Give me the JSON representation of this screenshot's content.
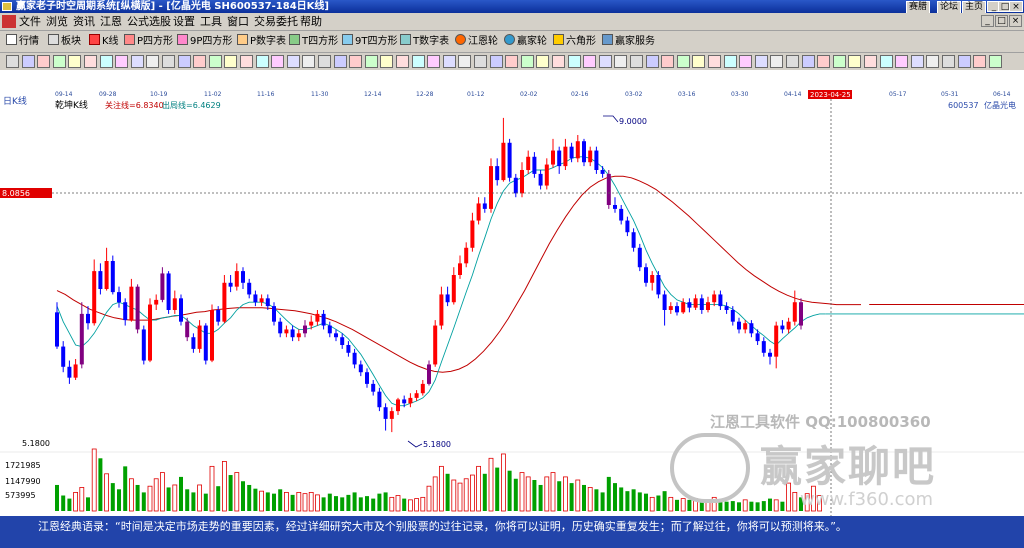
{
  "window": {
    "title": "赢家老子时空周期系统[纵横版] - [亿晶光电   SH600537-184日K线]",
    "top_links": [
      "赛腊",
      "论坛",
      "主页"
    ],
    "controls": [
      "_",
      "□",
      "×"
    ]
  },
  "menu": [
    "文件",
    "浏览",
    "资讯",
    "江恩",
    "公式选股",
    "设置",
    "工具",
    "窗口",
    "交易委托",
    "帮助"
  ],
  "toolbar": [
    {
      "label": "行情",
      "icon": "quote-table-icon"
    },
    {
      "label": "板块",
      "icon": "sector-icon"
    },
    {
      "label": "K线",
      "icon": "kline-icon"
    },
    {
      "label": "P四方形",
      "icon": "p-square-icon"
    },
    {
      "label": "9P四方形",
      "icon": "9p-square-icon"
    },
    {
      "label": "P数字表",
      "icon": "p-number-table-icon"
    },
    {
      "label": "T四方形",
      "icon": "t-square-icon"
    },
    {
      "label": "9T四方形",
      "icon": "9t-square-icon"
    },
    {
      "label": "T数字表",
      "icon": "t-number-table-icon"
    },
    {
      "label": "江恩轮",
      "icon": "gann-wheel-icon"
    },
    {
      "label": "赢家轮",
      "icon": "winner-wheel-icon"
    },
    {
      "label": "六角形",
      "icon": "hexagon-icon"
    },
    {
      "label": "赢家服务",
      "icon": "service-icon"
    }
  ],
  "chart": {
    "period_label": "日K线",
    "indicator_label": "乾坤K线",
    "watch_line_label": "关注线=6.8340",
    "exit_line_label": "出局线=6.4629",
    "code_label": "600537",
    "stock_name": "亿晶光电",
    "price_tag": "8.0856",
    "high_label": "9.0000",
    "low_label": "5.1800",
    "axis_low": "5.1800",
    "cursor_date": "2023-04-25",
    "watermark_line1": "江恩工具软件  QQ:100800360",
    "watermark_line2": "赢家聊吧",
    "watermark_line3": "www.f360.com",
    "colors": {
      "up": "#ff0000",
      "down": "#0000ff",
      "special": "#800080",
      "ma_short": "#00a0a0",
      "ma_long": "#c00000"
    }
  },
  "dates": [
    "09-14",
    "09-28",
    "10-19",
    "11-02",
    "11-16",
    "11-30",
    "12-14",
    "12-28",
    "01-12",
    "02-02",
    "02-16",
    "03-02",
    "03-16",
    "03-30",
    "04-14",
    "2023-04-25",
    "05-17",
    "05-31",
    "06-14"
  ],
  "volume": {
    "labels": [
      "1721985",
      "1147990",
      "573995"
    ]
  },
  "chart_data": {
    "type": "candlestick",
    "candles": [
      [
        6.72,
        6.28,
        6.85,
        6.25
      ],
      [
        6.28,
        6.02,
        6.35,
        5.95
      ],
      [
        6.02,
        5.88,
        6.1,
        5.8
      ],
      [
        5.88,
        6.05,
        6.12,
        5.85
      ],
      [
        6.05,
        6.7,
        6.85,
        6.0
      ],
      [
        6.7,
        6.58,
        6.8,
        6.5
      ],
      [
        6.58,
        7.25,
        7.4,
        6.55
      ],
      [
        7.25,
        7.02,
        7.35,
        6.95
      ],
      [
        7.02,
        7.38,
        7.55,
        7.0
      ],
      [
        7.38,
        6.98,
        7.45,
        6.95
      ],
      [
        6.98,
        6.85,
        7.05,
        6.78
      ],
      [
        6.85,
        6.62,
        6.9,
        6.55
      ],
      [
        6.62,
        7.05,
        7.15,
        6.6
      ],
      [
        7.05,
        6.5,
        7.08,
        6.45
      ],
      [
        6.5,
        6.1,
        6.55,
        6.05
      ],
      [
        6.1,
        6.82,
        6.9,
        6.08
      ],
      [
        6.82,
        6.88,
        6.95,
        6.75
      ],
      [
        6.88,
        7.22,
        7.3,
        6.85
      ],
      [
        7.22,
        6.75,
        7.25,
        6.7
      ],
      [
        6.75,
        6.9,
        7.0,
        6.7
      ],
      [
        6.9,
        6.6,
        6.95,
        6.55
      ],
      [
        6.6,
        6.4,
        6.65,
        6.35
      ],
      [
        6.4,
        6.25,
        6.45,
        6.2
      ],
      [
        6.25,
        6.55,
        6.62,
        6.2
      ],
      [
        6.55,
        6.1,
        6.58,
        6.05
      ],
      [
        6.1,
        6.75,
        6.82,
        6.08
      ],
      [
        6.75,
        6.6,
        6.8,
        6.55
      ],
      [
        6.6,
        7.1,
        7.2,
        6.58
      ],
      [
        7.1,
        7.05,
        7.2,
        6.98
      ],
      [
        7.05,
        7.25,
        7.35,
        7.0
      ],
      [
        7.25,
        7.1,
        7.3,
        7.02
      ],
      [
        7.1,
        6.95,
        7.15,
        6.9
      ],
      [
        6.95,
        6.85,
        7.0,
        6.8
      ],
      [
        6.85,
        6.9,
        6.95,
        6.8
      ],
      [
        6.9,
        6.8,
        6.95,
        6.75
      ],
      [
        6.8,
        6.6,
        6.85,
        6.55
      ],
      [
        6.6,
        6.45,
        6.65,
        6.4
      ],
      [
        6.45,
        6.5,
        6.55,
        6.4
      ],
      [
        6.5,
        6.4,
        6.55,
        6.35
      ],
      [
        6.4,
        6.45,
        6.5,
        6.35
      ],
      [
        6.45,
        6.55,
        6.62,
        6.4
      ],
      [
        6.55,
        6.6,
        6.68,
        6.5
      ],
      [
        6.6,
        6.7,
        6.75,
        6.55
      ],
      [
        6.7,
        6.55,
        6.75,
        6.5
      ],
      [
        6.55,
        6.45,
        6.6,
        6.4
      ],
      [
        6.45,
        6.4,
        6.5,
        6.35
      ],
      [
        6.4,
        6.3,
        6.45,
        6.25
      ],
      [
        6.3,
        6.2,
        6.35,
        6.15
      ],
      [
        6.2,
        6.05,
        6.25,
        6.0
      ],
      [
        6.05,
        5.95,
        6.1,
        5.9
      ],
      [
        5.95,
        5.8,
        6.0,
        5.75
      ],
      [
        5.8,
        5.7,
        5.85,
        5.65
      ],
      [
        5.7,
        5.5,
        5.75,
        5.45
      ],
      [
        5.5,
        5.35,
        5.55,
        5.2
      ],
      [
        5.35,
        5.45,
        5.5,
        5.18
      ],
      [
        5.45,
        5.6,
        5.62,
        5.4
      ],
      [
        5.6,
        5.55,
        5.65,
        5.5
      ],
      [
        5.55,
        5.62,
        5.68,
        5.5
      ],
      [
        5.62,
        5.68,
        5.72,
        5.58
      ],
      [
        5.68,
        5.8,
        5.85,
        5.65
      ],
      [
        5.8,
        6.05,
        6.1,
        5.78
      ],
      [
        6.05,
        6.55,
        6.62,
        6.02
      ],
      [
        6.55,
        6.95,
        7.05,
        6.5
      ],
      [
        6.95,
        6.85,
        7.05,
        6.8
      ],
      [
        6.85,
        7.2,
        7.3,
        6.82
      ],
      [
        7.2,
        7.35,
        7.45,
        7.15
      ],
      [
        7.35,
        7.55,
        7.62,
        7.3
      ],
      [
        7.55,
        7.9,
        8.0,
        7.5
      ],
      [
        7.9,
        8.12,
        8.2,
        7.85
      ],
      [
        8.12,
        8.05,
        8.2,
        8.0
      ],
      [
        8.05,
        8.6,
        8.7,
        8.0
      ],
      [
        8.6,
        8.42,
        8.7,
        8.35
      ],
      [
        8.42,
        8.9,
        9.22,
        8.4
      ],
      [
        8.9,
        8.45,
        8.95,
        8.4
      ],
      [
        8.45,
        8.25,
        8.5,
        8.2
      ],
      [
        8.25,
        8.55,
        8.65,
        8.2
      ],
      [
        8.55,
        8.72,
        8.8,
        8.5
      ],
      [
        8.72,
        8.5,
        8.78,
        8.45
      ],
      [
        8.5,
        8.35,
        8.55,
        8.3
      ],
      [
        8.35,
        8.62,
        8.7,
        8.3
      ],
      [
        8.62,
        8.8,
        8.95,
        8.58
      ],
      [
        8.8,
        8.6,
        8.85,
        8.5
      ],
      [
        8.6,
        8.85,
        8.95,
        8.55
      ],
      [
        8.85,
        8.7,
        8.9,
        8.65
      ],
      [
        8.7,
        8.92,
        9.0,
        8.65
      ],
      [
        8.92,
        8.65,
        8.95,
        8.6
      ],
      [
        8.65,
        8.8,
        8.85,
        8.6
      ],
      [
        8.8,
        8.55,
        8.85,
        8.5
      ],
      [
        8.55,
        8.5,
        8.6,
        8.45
      ],
      [
        8.5,
        8.1,
        8.55,
        8.05
      ],
      [
        8.1,
        8.05,
        8.2,
        8.0
      ],
      [
        8.05,
        7.9,
        8.1,
        7.85
      ],
      [
        7.9,
        7.75,
        7.95,
        7.7
      ],
      [
        7.75,
        7.55,
        7.8,
        7.5
      ],
      [
        7.55,
        7.3,
        7.6,
        7.25
      ],
      [
        7.3,
        7.1,
        7.35,
        7.05
      ],
      [
        7.1,
        7.2,
        7.25,
        7.0
      ],
      [
        7.2,
        6.95,
        7.25,
        6.9
      ],
      [
        6.95,
        6.75,
        7.0,
        6.55
      ],
      [
        6.75,
        6.8,
        6.85,
        6.7
      ],
      [
        6.8,
        6.72,
        6.85,
        6.68
      ],
      [
        6.72,
        6.85,
        6.9,
        6.7
      ],
      [
        6.85,
        6.78,
        6.9,
        6.72
      ],
      [
        6.78,
        6.9,
        6.95,
        6.75
      ],
      [
        6.9,
        6.75,
        6.95,
        6.7
      ],
      [
        6.75,
        6.85,
        6.92,
        6.72
      ],
      [
        6.85,
        6.95,
        7.0,
        6.8
      ],
      [
        6.95,
        6.8,
        7.0,
        6.75
      ],
      [
        6.8,
        6.75,
        6.85,
        6.7
      ],
      [
        6.75,
        6.6,
        6.8,
        6.55
      ],
      [
        6.6,
        6.5,
        6.65,
        6.45
      ],
      [
        6.5,
        6.58,
        6.62,
        6.45
      ],
      [
        6.58,
        6.45,
        6.62,
        6.4
      ],
      [
        6.45,
        6.35,
        6.5,
        6.3
      ],
      [
        6.35,
        6.2,
        6.4,
        6.15
      ],
      [
        6.2,
        6.15,
        6.25,
        6.05
      ],
      [
        6.15,
        6.55,
        6.6,
        6.0
      ],
      [
        6.55,
        6.5,
        6.62,
        6.45
      ],
      [
        6.5,
        6.6,
        6.65,
        6.45
      ],
      [
        6.6,
        6.85,
        7.0,
        6.55
      ],
      [
        6.85,
        6.55,
        6.9,
        6.5
      ]
    ],
    "special_purple_indices": [
      4,
      13,
      17,
      21,
      40,
      60,
      89,
      120
    ],
    "ma_short": [
      6.8,
      6.6,
      6.45,
      6.3,
      6.28,
      6.35,
      6.45,
      6.58,
      6.72,
      6.82,
      6.85,
      6.82,
      6.78,
      6.75,
      6.68,
      6.62,
      6.62,
      6.65,
      6.66,
      6.68,
      6.68,
      6.62,
      6.55,
      6.5,
      6.45,
      6.45,
      6.5,
      6.58,
      6.65,
      6.75,
      6.82,
      6.85,
      6.85,
      6.85,
      6.83,
      6.78,
      6.7,
      6.62,
      6.55,
      6.5,
      6.5,
      6.52,
      6.55,
      6.58,
      6.55,
      6.5,
      6.45,
      6.38,
      6.28,
      6.18,
      6.05,
      5.92,
      5.78,
      5.65,
      5.55,
      5.52,
      5.52,
      5.55,
      5.58,
      5.62,
      5.7,
      5.85,
      6.08,
      6.3,
      6.52,
      6.75,
      6.98,
      7.2,
      7.45,
      7.68,
      7.92,
      8.12,
      8.28,
      8.38,
      8.42,
      8.45,
      8.5,
      8.55,
      8.55,
      8.55,
      8.58,
      8.62,
      8.65,
      8.7,
      8.72,
      8.72,
      8.7,
      8.65,
      8.58,
      8.48,
      8.35,
      8.2,
      8.05,
      7.9,
      7.72,
      7.52,
      7.35,
      7.2,
      7.05,
      6.95,
      6.88,
      6.85,
      6.82,
      6.82,
      6.82,
      6.82,
      6.82,
      6.82,
      6.8,
      6.76,
      6.7,
      6.62,
      6.55,
      6.48,
      6.42,
      6.35,
      6.3,
      6.38,
      6.45,
      6.52,
      6.6,
      6.65,
      6.68,
      6.7,
      6.7
    ],
    "ma_long": [
      7.0,
      6.95,
      6.88,
      6.82,
      6.76,
      6.72,
      6.68,
      6.65,
      6.63,
      6.62,
      6.62,
      6.62,
      6.63,
      6.65,
      6.67,
      6.68,
      6.7,
      6.72,
      6.73,
      6.75,
      6.76,
      6.77,
      6.78,
      6.78,
      6.78,
      6.78,
      6.77,
      6.76,
      6.75,
      6.74,
      6.72,
      6.7,
      6.67,
      6.64,
      6.6,
      6.55,
      6.5,
      6.44,
      6.38,
      6.32,
      6.26,
      6.2,
      6.14,
      6.08,
      6.03,
      5.99,
      5.96,
      5.95,
      5.96,
      5.99,
      6.04,
      6.12,
      6.22,
      6.34,
      6.48,
      6.64,
      6.82,
      7.0,
      7.2,
      7.4,
      7.6,
      7.78,
      7.95,
      8.1,
      8.23,
      8.33,
      8.4,
      8.45,
      8.47,
      8.47,
      8.45,
      8.41,
      8.36,
      8.3,
      8.22,
      8.14,
      8.05,
      7.96,
      7.86,
      7.76,
      7.66,
      7.56,
      7.46,
      7.36,
      7.27,
      7.19,
      7.12,
      7.05,
      6.99,
      6.94,
      6.9,
      6.87,
      6.85,
      6.84,
      6.83,
      6.82,
      6.82,
      6.82,
      6.82
    ],
    "volume_max": 1721985,
    "volumes": [
      0.42,
      0.25,
      0.2,
      0.3,
      0.38,
      0.22,
      1.0,
      0.85,
      0.6,
      0.45,
      0.35,
      0.72,
      0.52,
      0.42,
      0.3,
      0.4,
      0.52,
      0.62,
      0.38,
      0.42,
      0.55,
      0.35,
      0.3,
      0.42,
      0.28,
      0.72,
      0.4,
      0.8,
      0.58,
      0.62,
      0.48,
      0.42,
      0.36,
      0.32,
      0.3,
      0.28,
      0.35,
      0.3,
      0.26,
      0.3,
      0.28,
      0.3,
      0.26,
      0.22,
      0.28,
      0.24,
      0.22,
      0.26,
      0.3,
      0.22,
      0.24,
      0.2,
      0.28,
      0.3,
      0.22,
      0.25,
      0.2,
      0.18,
      0.2,
      0.22,
      0.4,
      0.55,
      0.72,
      0.6,
      0.5,
      0.45,
      0.52,
      0.58,
      0.72,
      0.6,
      0.85,
      0.7,
      0.92,
      0.65,
      0.52,
      0.62,
      0.55,
      0.5,
      0.42,
      0.55,
      0.62,
      0.48,
      0.55,
      0.45,
      0.5,
      0.42,
      0.38,
      0.35,
      0.3,
      0.55,
      0.45,
      0.38,
      0.32,
      0.35,
      0.3,
      0.28,
      0.22,
      0.25,
      0.32,
      0.22,
      0.18,
      0.2,
      0.18,
      0.2,
      0.16,
      0.18,
      0.22,
      0.18,
      0.15,
      0.16,
      0.14,
      0.18,
      0.15,
      0.14,
      0.16,
      0.2,
      0.18,
      0.15,
      0.45,
      0.3,
      0.22,
      0.28,
      0.4,
      0.25
    ],
    "ylim": [
      4.95,
      9.45
    ]
  },
  "status": {
    "quote": "江恩经典语录：“时间是决定市场走势的重要因素，经过详细研究大市及个别股票的过往记录，你将可以证明，历史确实重复发生；而了解过往，你将可以预测将来。”。"
  }
}
